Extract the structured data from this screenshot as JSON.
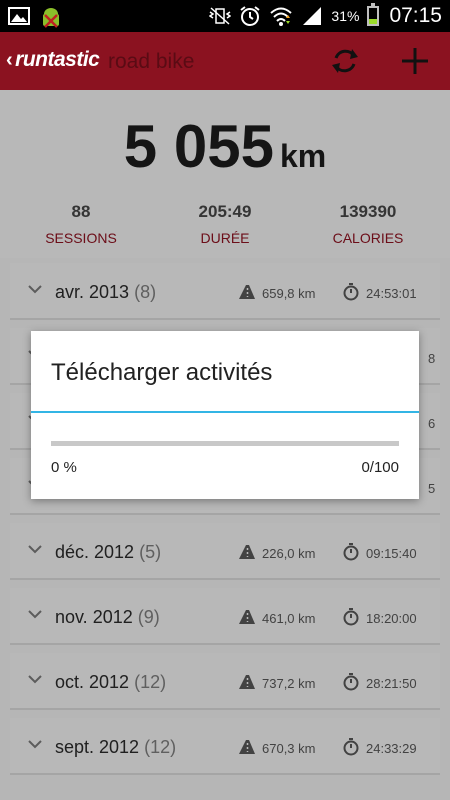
{
  "status_bar": {
    "battery_percent": "31%",
    "battery_level": 0.31,
    "time": "07:15"
  },
  "action_bar": {
    "brand": "runtastic",
    "subtitle": "road bike",
    "icons": [
      "sync-icon",
      "add-icon"
    ]
  },
  "summary": {
    "total_distance": "5 055",
    "unit": "km",
    "stats": [
      {
        "value": "88",
        "label": "SESSIONS"
      },
      {
        "value": "205:49",
        "label": "DURÉE"
      },
      {
        "value": "139390",
        "label": "CALORIES"
      }
    ]
  },
  "months": [
    {
      "month": "avr. 2013",
      "count": "(8)",
      "distance": "659,8 km",
      "duration": "24:53:01"
    },
    {
      "month": "",
      "count": "",
      "distance": "",
      "duration": "8"
    },
    {
      "month": "",
      "count": "",
      "distance": "",
      "duration": "6"
    },
    {
      "month": "",
      "count": "",
      "distance": "",
      "duration": "5"
    },
    {
      "month": "déc. 2012",
      "count": "(5)",
      "distance": "226,0 km",
      "duration": "09:15:40"
    },
    {
      "month": "nov. 2012",
      "count": "(9)",
      "distance": "461,0 km",
      "duration": "18:20:00"
    },
    {
      "month": "oct. 2012",
      "count": "(12)",
      "distance": "737,2 km",
      "duration": "28:21:50"
    },
    {
      "month": "sept. 2012",
      "count": "(12)",
      "distance": "670,3 km",
      "duration": "24:33:29"
    }
  ],
  "dialog": {
    "title": "Télécharger activités",
    "percent": "0 %",
    "count": "0/100",
    "progress": 0
  },
  "colors": {
    "brand_red": "#8b1220",
    "accent_blue": "#33b5e5"
  }
}
